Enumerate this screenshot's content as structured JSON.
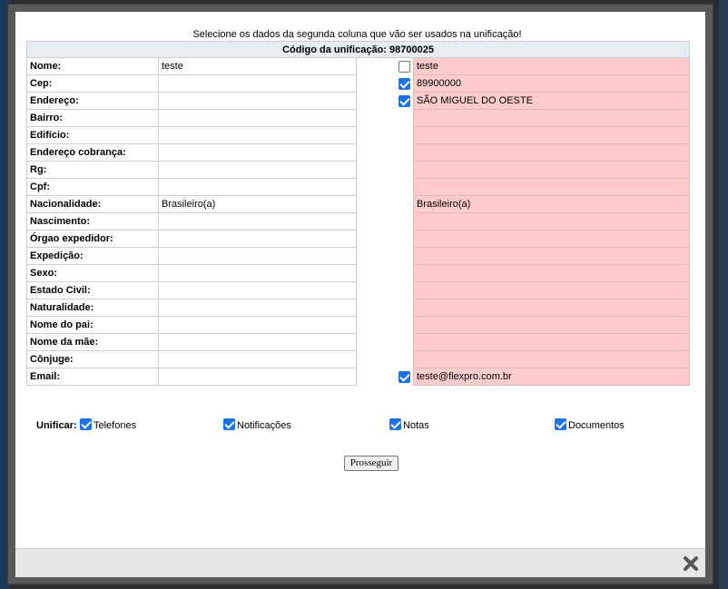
{
  "instruction": "Selecione os dados da segunda coluna que vão ser usados na unificação!",
  "code_header": "Código da unificação: 98700025",
  "rows": [
    {
      "label": "Nome:",
      "current": "teste",
      "checkbox": "unchecked",
      "new": "teste"
    },
    {
      "label": "Cep:",
      "current": "",
      "checkbox": "checked",
      "new": "89900000"
    },
    {
      "label": "Endereço:",
      "current": "",
      "checkbox": "checked",
      "new": "SÃO MIGUEL DO OESTE"
    },
    {
      "label": "Bairro:",
      "current": "",
      "checkbox": "none",
      "new": ""
    },
    {
      "label": "Edifício:",
      "current": "",
      "checkbox": "none",
      "new": ""
    },
    {
      "label": "Endereço cobrança:",
      "current": "",
      "checkbox": "none",
      "new": ""
    },
    {
      "label": "Rg:",
      "current": "",
      "checkbox": "none",
      "new": ""
    },
    {
      "label": "Cpf:",
      "current": "",
      "checkbox": "none",
      "new": ""
    },
    {
      "label": "Nacionalidade:",
      "current": "Brasileiro(a)",
      "checkbox": "none",
      "new": "Brasileiro(a)"
    },
    {
      "label": "Nascimento:",
      "current": "",
      "checkbox": "none",
      "new": ""
    },
    {
      "label": "Órgao expedidor:",
      "current": "",
      "checkbox": "none",
      "new": ""
    },
    {
      "label": "Expedição:",
      "current": "",
      "checkbox": "none",
      "new": ""
    },
    {
      "label": "Sexo:",
      "current": "",
      "checkbox": "none",
      "new": ""
    },
    {
      "label": "Estado Civil:",
      "current": "",
      "checkbox": "none",
      "new": ""
    },
    {
      "label": "Naturalidade:",
      "current": "",
      "checkbox": "none",
      "new": ""
    },
    {
      "label": "Nome do pai:",
      "current": "",
      "checkbox": "none",
      "new": ""
    },
    {
      "label": "Nome da mãe:",
      "current": "",
      "checkbox": "none",
      "new": ""
    },
    {
      "label": "Cônjuge:",
      "current": "",
      "checkbox": "none",
      "new": ""
    },
    {
      "label": "Email:",
      "current": "",
      "checkbox": "checked",
      "new": "teste@flexpro.com.br"
    }
  ],
  "unify": {
    "label": "Unificar:",
    "options": [
      {
        "label": "Telefones",
        "checked": true
      },
      {
        "label": "Notificações",
        "checked": true
      },
      {
        "label": "Notas",
        "checked": true
      },
      {
        "label": "Documentos",
        "checked": true
      }
    ]
  },
  "proceed_label": "Prosseguir",
  "icons": {
    "close": "close-icon"
  },
  "colors": {
    "new_value_bg": "#ffcccc",
    "header_bg": "#e7ecf1",
    "checkbox_on": "#1a73e8"
  }
}
